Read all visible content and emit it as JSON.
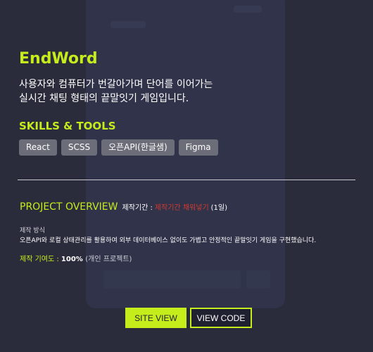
{
  "project": {
    "title": "EndWord",
    "description_lines": [
      "사용자와 컴퓨터가 번갈아가며 단어를 이어가는",
      "실시간 채팅 형태의 끝말잇기 게임입니다."
    ]
  },
  "skills": {
    "heading": "SKILLS & TOOLS",
    "tags": [
      "React",
      "SCSS",
      "오픈API(한글샘)",
      "Figma"
    ]
  },
  "overview": {
    "heading": "PROJECT OVERVIEW",
    "period_label": "제작기간 :",
    "period_value": "제작기간 채워넣기",
    "period_days": "(1일)",
    "method_label": "제작 방식",
    "method_text": "오픈API와 로컬 상태관리를 활용하여 외부 데이터베이스 없이도 가볍고 안정적인  끝말잇기 게임을 구현했습니다.",
    "contribution_label": "제작 기여도 :",
    "contribution_value": "100%",
    "contribution_note": "(개인 프로젝트)"
  },
  "buttons": {
    "site_view": "SITE VIEW",
    "view_code": "VIEW CODE"
  },
  "colors": {
    "accent": "#c5ec1b",
    "background": "#2a2c3b",
    "period_highlight": "#d33a2f",
    "tag_bg": "#6b6e78"
  }
}
